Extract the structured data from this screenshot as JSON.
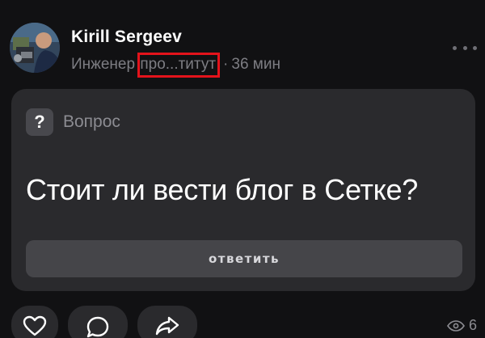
{
  "author": {
    "name": "Kirill Sergeev",
    "role_start": "Инженер ",
    "role_highlight": "про...титут",
    "separator": "·",
    "time": "36 мин"
  },
  "card": {
    "type_icon": "?",
    "type_label": "Вопрос",
    "question": "Стоит ли вести блог в Сетке?",
    "answer_label": "ответить"
  },
  "actions": {
    "icons": [
      "heart-icon",
      "comment-icon",
      "share-icon"
    ],
    "views_count": "6"
  },
  "colors": {
    "background": "#111113",
    "card": "#2a2a2d",
    "highlight_border": "#e3131b",
    "muted_text": "#7d7d83"
  }
}
